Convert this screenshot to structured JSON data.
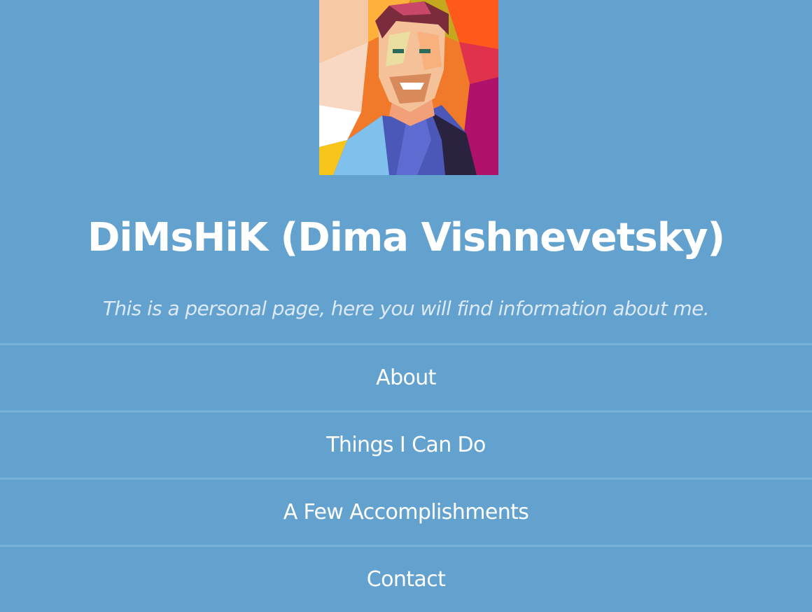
{
  "header": {
    "title": "DiMsHiK (Dima Vishnevetsky)",
    "subtitle": "This is a personal page, here you will find information about me."
  },
  "nav": {
    "items": [
      {
        "label": "About"
      },
      {
        "label": "Things I Can Do"
      },
      {
        "label": "A Few Accomplishments"
      },
      {
        "label": "Contact"
      }
    ]
  },
  "colors": {
    "background": "#63a2cf",
    "divider": "#77b0d8",
    "text": "#ffffff",
    "subtitle": "#dde9f5"
  }
}
